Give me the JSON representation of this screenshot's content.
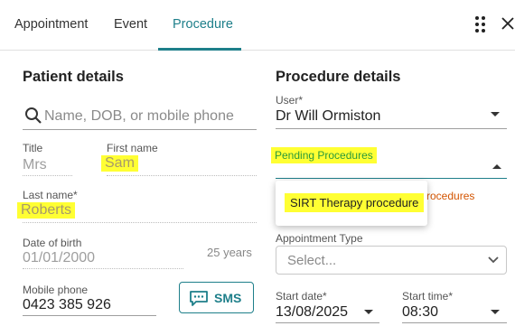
{
  "tabs": [
    {
      "label": "Appointment"
    },
    {
      "label": "Event"
    },
    {
      "label": "Procedure"
    }
  ],
  "patient": {
    "title": "Patient details",
    "search_placeholder": "Name, DOB, or mobile phone",
    "title_label": "Title",
    "title_value": "Mrs",
    "first_name_label": "First name",
    "first_name_value": "Sam",
    "last_name_label": "Last name*",
    "last_name_value": "Roberts",
    "dob_label": "Date of birth",
    "dob_value": "01/01/2000",
    "age": "25 years",
    "mobile_label": "Mobile phone",
    "mobile_value": "0423 385 926",
    "sms_label": "SMS"
  },
  "procedure": {
    "title": "Procedure details",
    "user_label": "User*",
    "user_value": "Dr Will Ormiston",
    "pending_label": "Pending Procedures",
    "pending_option": "SIRT Therapy procedure",
    "partial_text": "rocedures",
    "appointment_type_label": "Appointment Type",
    "appointment_type_placeholder": "Select...",
    "start_date_label": "Start date*",
    "start_date_value": "13/08/2025",
    "start_time_label": "Start time*",
    "start_time_value": "08:30"
  },
  "colors": {
    "accent": "#1e7f8a",
    "highlight": "#ffff33",
    "pending_green": "#2a9a3a",
    "warning_orange": "#d35400"
  },
  "icons": [
    "apps-grid-icon",
    "close-icon",
    "search-icon",
    "sms-chat-icon",
    "chevron-down-icon"
  ]
}
